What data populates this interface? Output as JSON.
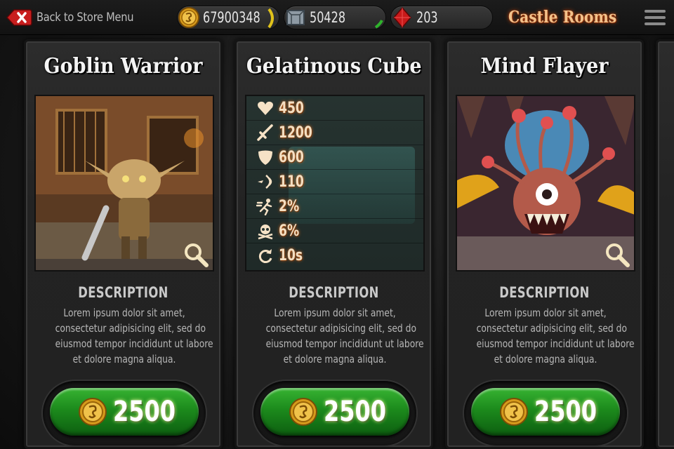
{
  "topbar": {
    "back_label": "Back to Store Menu",
    "gold": "67900348",
    "stone": "50428",
    "gems": "203",
    "title": "Castle Rooms"
  },
  "cards": [
    {
      "name": "Goblin Warrior",
      "desc_heading": "DESCRIPTION",
      "desc_lines": [
        "Lorem ipsum dolor sit amet,",
        "consectetur adipisicing elit, sed do",
        "eiusmod tempor incididunt ut labore",
        "et dolore magna aliqua."
      ],
      "price": "2500"
    },
    {
      "name": "Gelatinous Cube",
      "stats": [
        {
          "icon": "heart-icon",
          "value": "450"
        },
        {
          "icon": "sword-icon",
          "value": "1200"
        },
        {
          "icon": "shield-icon",
          "value": "600"
        },
        {
          "icon": "speed-icon",
          "value": "110"
        },
        {
          "icon": "running-man-icon",
          "value": "2%"
        },
        {
          "icon": "skull-icon",
          "value": "6%"
        },
        {
          "icon": "refresh-icon",
          "value": "10s"
        }
      ],
      "desc_heading": "DESCRIPTION",
      "desc_lines": [
        "Lorem ipsum dolor sit amet,",
        "consectetur adipisicing elit, sed do",
        "eiusmod tempor incididunt ut labore",
        "et dolore magna aliqua."
      ],
      "price": "2500"
    },
    {
      "name": "Mind Flayer",
      "desc_heading": "DESCRIPTION",
      "desc_lines": [
        "Lorem ipsum dolor sit amet,",
        "consectetur adipisicing elit, sed do",
        "eiusmod tempor incididunt ut labore",
        "et dolore magna aliqua."
      ],
      "price": "2500"
    }
  ],
  "colors": {
    "title_glow": "#f2c28b",
    "price_green": "#1c8a1c",
    "stat_text": "#f4dfc2"
  }
}
